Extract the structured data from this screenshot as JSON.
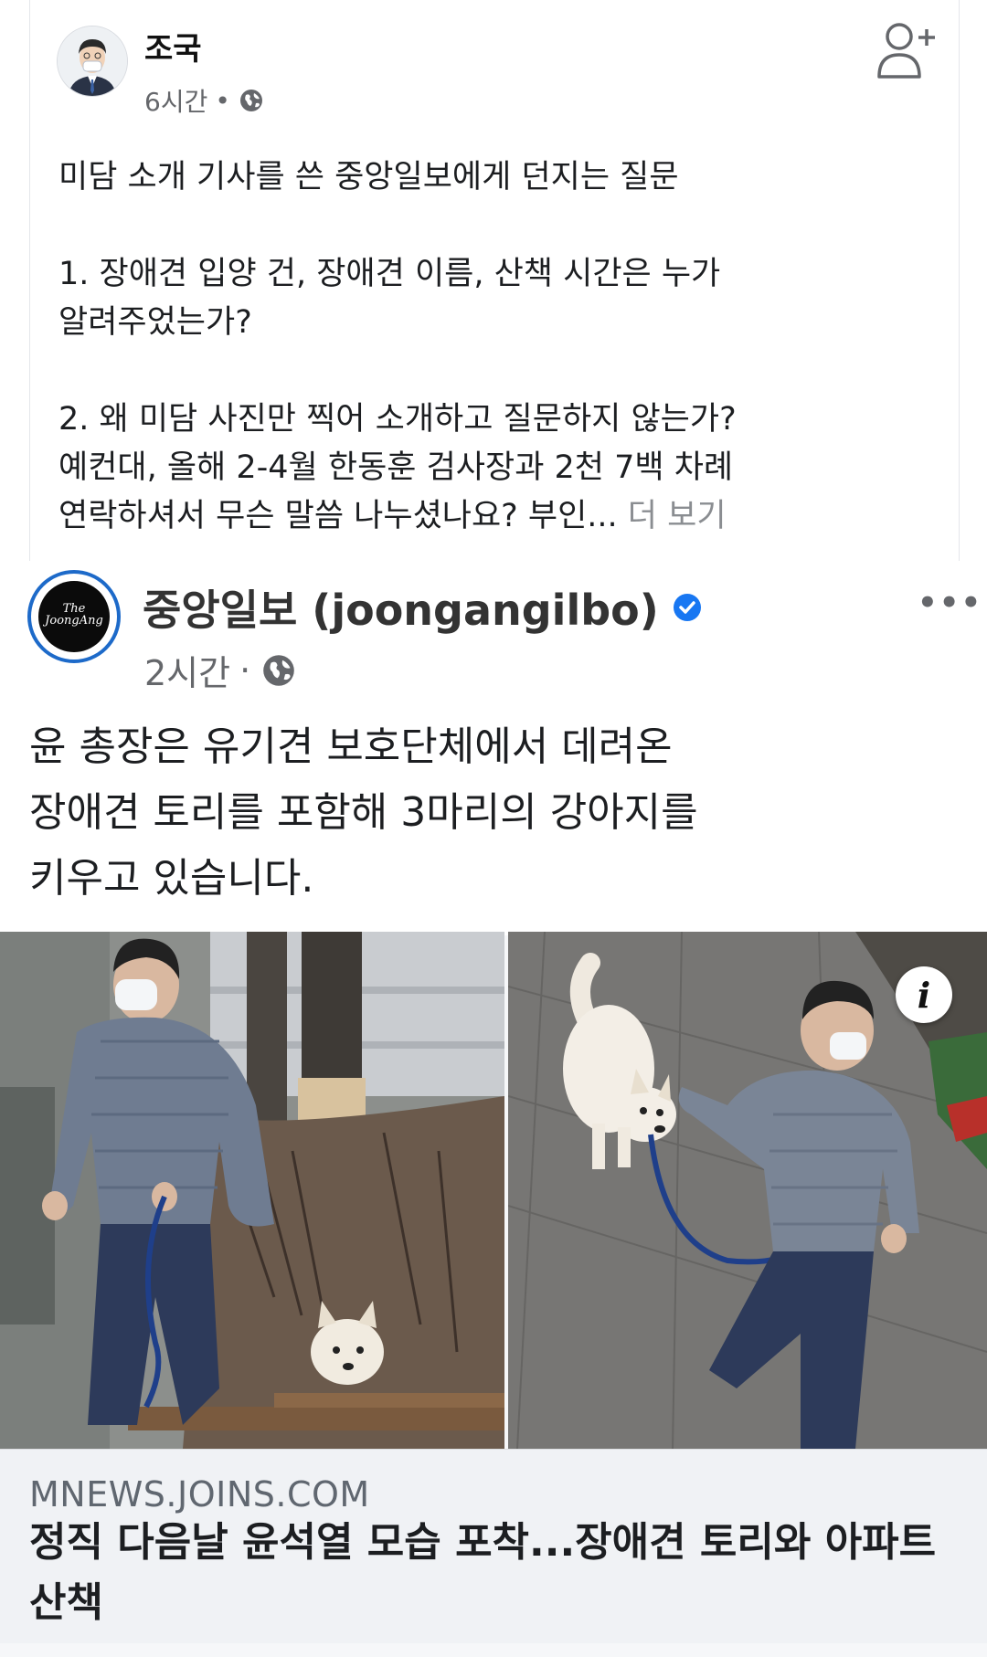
{
  "post": {
    "author": "조국",
    "time": "6시간",
    "dot": "•",
    "privacy_icon": "globe-icon",
    "body": {
      "intro": "미담 소개 기사를 쓴 중앙일보에게 던지는 질문",
      "q1_line1": "1. 장애견 입양 건, 장애견 이름, 산책 시간은 누가",
      "q1_line2": "알려주었는가?",
      "q2_line1": "2. 왜 미담 사진만 찍어 소개하고 질문하지 않는가?",
      "q2_line2": "예컨대, 올해 2-4월 한동훈 검사장과 2천 7백 차례",
      "q2_line3": "연락하셔서 무슨 말씀 나누셨나요? 부인...",
      "see_more": "더 보기"
    },
    "add_friend_icon": "add-friend-icon"
  },
  "shared": {
    "logo_line1": "The",
    "logo_line2": "JoongAng",
    "page_name": "중앙일보 (joongangilbo)",
    "verified_icon": "verified-badge-icon",
    "time": "2시간",
    "dot": "·",
    "more_icon": "more-options-icon",
    "more_label": "•••",
    "text_line1": "윤 총장은 유기견 보호단체에서 데려온",
    "text_line2": "장애견 토리를 포함해 3마리의 강아지를",
    "text_line3": "키우고 있습니다.",
    "info_label": "i",
    "link": {
      "domain": "MNEWS.JOINS.COM",
      "title_line1": "정직 다음날 윤석열 모습 포착...장애견 토리와 아파트",
      "title_line2": "산책"
    }
  },
  "colors": {
    "verified": "#1877f2",
    "logo_ring": "#1d6ac9",
    "meta_text": "#65676b",
    "link_bg": "#f0f2f5"
  }
}
